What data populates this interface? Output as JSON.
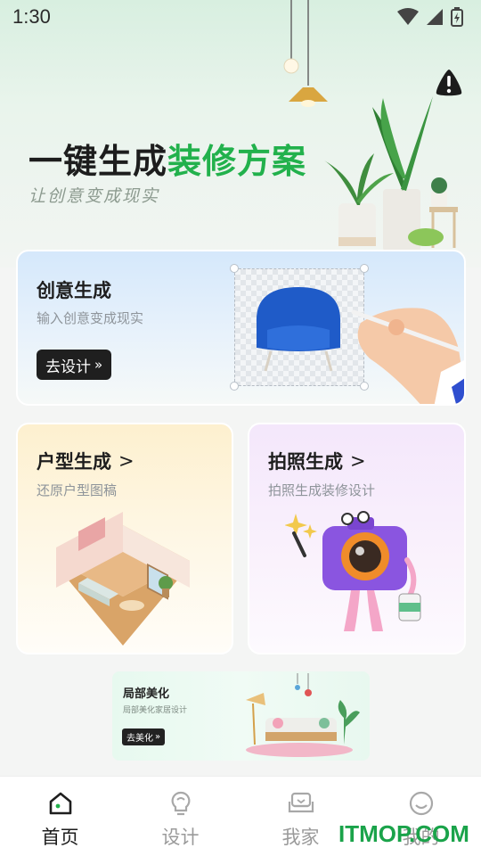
{
  "status_bar": {
    "time": "1:30"
  },
  "hero": {
    "title_main": "一键生成",
    "title_accent": "装修方案",
    "subtitle": "让创意变成现实"
  },
  "cards": {
    "create": {
      "title": "创意生成",
      "desc": "输入创意变成现实",
      "button": "去设计"
    },
    "floor": {
      "title": "户型生成",
      "desc": "还原户型图稿"
    },
    "photo": {
      "title": "拍照生成",
      "desc": "拍照生成装修设计"
    },
    "beauty": {
      "title": "局部美化",
      "desc": "局部美化家居设计",
      "button": "去美化"
    }
  },
  "tabbar": {
    "items": [
      {
        "label": "首页",
        "icon": "home-icon",
        "active": true
      },
      {
        "label": "设计",
        "icon": "lightbulb-icon",
        "active": false
      },
      {
        "label": "我家",
        "icon": "sofa-icon",
        "active": false
      },
      {
        "label": "我的",
        "icon": "smiley-icon",
        "active": false
      }
    ]
  },
  "watermark": "ITMOP.COM",
  "colors": {
    "accent": "#22b14c",
    "dark": "#1f1f1f"
  }
}
